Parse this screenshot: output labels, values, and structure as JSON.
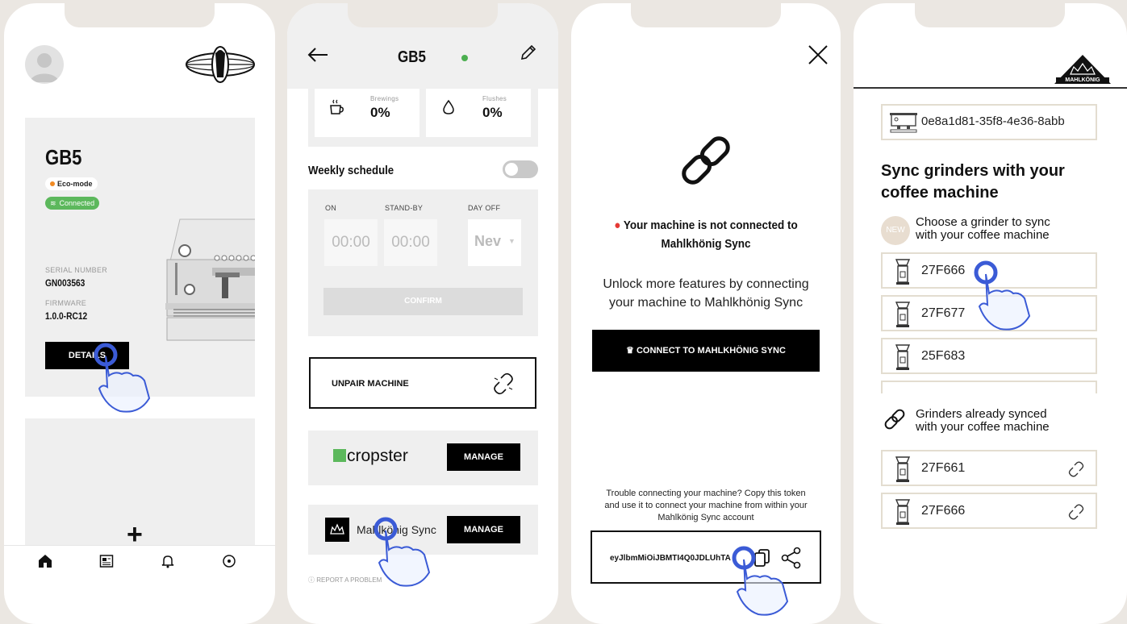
{
  "screen1": {
    "title": "GB5",
    "badge_eco": "Eco-mode",
    "badge_connected": "Connected",
    "serial_label": "SERIAL NUMBER",
    "serial_value": "GN003563",
    "firmware_label": "FIRMWARE",
    "firmware_value": "1.0.0-RC12",
    "details_button": "DETAILS",
    "add_symbol": "+",
    "tabs": [
      "home-icon",
      "news-icon",
      "bell-icon",
      "location-icon"
    ]
  },
  "screen2": {
    "title": "GB5",
    "status_color": "#4caf50",
    "stat_brewings_label": "Brewings",
    "stat_brewings_value": "0%",
    "stat_flushes_label": "Flushes",
    "stat_flushes_value": "0%",
    "weekly_schedule_label": "Weekly schedule",
    "col_on": "ON",
    "col_standby": "STAND-BY",
    "col_dayoff": "DAY OFF",
    "on_time": "00:00",
    "standby_time": "00:00",
    "dayoff_value": "Nev",
    "confirm_button": "CONFIRM",
    "unpair_label": "UNPAIR MACHINE",
    "cropster_label": "cropster",
    "manage_button_1": "MANAGE",
    "mahlkonig_label": "Mahlkönig Sync",
    "manage_button_2": "MANAGE",
    "report_problem": "REPORT A PROBLEM"
  },
  "screen3": {
    "not_connected_line1": "Your machine is not connected to",
    "not_connected_line2": "Mahlkhönig Sync",
    "status_dot_color": "#e53935",
    "unlock_line1": "Unlock more features by connecting",
    "unlock_line2": "your machine to Mahlkhönig Sync",
    "connect_button": "CONNECT TO MAHLKHÖNIG SYNC",
    "trouble_line1": "Trouble connecting your machine? Copy this token",
    "trouble_line2": "and use it to connect your machine from within your",
    "trouble_line3": "Mahlkönig Sync account",
    "token": "eyJlbmMiOiJBMTI4Q0JDLUhTA..."
  },
  "screen4": {
    "brand": "MAHLKÖNIG",
    "machine_id": "0e8a1d81-35f8-4e36-8abb",
    "heading_line1": "Sync grinders with your",
    "heading_line2": "coffee machine",
    "new_badge": "NEW",
    "choose_line1": "Choose a grinder to sync",
    "choose_line2": "with your coffee machine",
    "grinders": [
      "27F666",
      "27F677",
      "25F683"
    ],
    "synced_line1": "Grinders already synced",
    "synced_line2": "with your coffee machine",
    "synced_grinders": [
      "27F661",
      "27F666"
    ]
  },
  "colors": {
    "background": "#ebe7e2",
    "accent_green": "#5cb85c",
    "border_beige": "#e3ddd0",
    "tap_blue": "#3b5bd6"
  }
}
